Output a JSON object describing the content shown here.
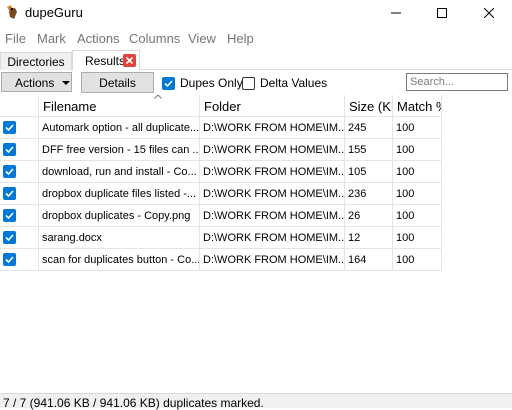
{
  "window": {
    "title": "dupeGuru"
  },
  "menu": [
    "File",
    "Mark",
    "Actions",
    "Columns",
    "View",
    "Help"
  ],
  "tabs": {
    "directories": "Directories",
    "results": "Results"
  },
  "toolbar": {
    "actions_label": "Actions",
    "details_label": "Details",
    "dupes_only_label": "Dupes Only",
    "dupes_only_checked": true,
    "delta_values_label": "Delta Values",
    "delta_values_checked": false,
    "search_placeholder": "Search..."
  },
  "table": {
    "columns": [
      "Filename",
      "Folder",
      "Size (KB)",
      "Match %"
    ],
    "rows": [
      {
        "checked": true,
        "filename": "Automark option - all duplicate...",
        "folder": "D:\\WORK FROM HOME\\IM...",
        "size": "245",
        "match": "100"
      },
      {
        "checked": true,
        "filename": "DFF free version - 15 files can ...",
        "folder": "D:\\WORK FROM HOME\\IM...",
        "size": "155",
        "match": "100"
      },
      {
        "checked": true,
        "filename": "download, run and install - Co...",
        "folder": "D:\\WORK FROM HOME\\IM...",
        "size": "105",
        "match": "100"
      },
      {
        "checked": true,
        "filename": "dropbox duplicate files listed  -...",
        "folder": "D:\\WORK FROM HOME\\IM...",
        "size": "236",
        "match": "100"
      },
      {
        "checked": true,
        "filename": "dropbox duplicates - Copy.png",
        "folder": "D:\\WORK FROM HOME\\IM...",
        "size": "26",
        "match": "100"
      },
      {
        "checked": true,
        "filename": "sarang.docx",
        "folder": "D:\\WORK FROM HOME\\IM...",
        "size": "12",
        "match": "100"
      },
      {
        "checked": true,
        "filename": "scan for duplicates button - Co...",
        "folder": "D:\\WORK FROM HOME\\IM...",
        "size": "164",
        "match": "100"
      }
    ]
  },
  "status": {
    "text": "7 / 7 (941.06 KB / 941.06 KB) duplicates marked."
  },
  "colors": {
    "accent": "#0078d7",
    "tab_close": "#e0443a",
    "menu_text": "#767676"
  },
  "icons": {
    "app": "dupeguru-logo-icon",
    "row_check": "checkmark-icon",
    "tab_close": "close-icon"
  }
}
